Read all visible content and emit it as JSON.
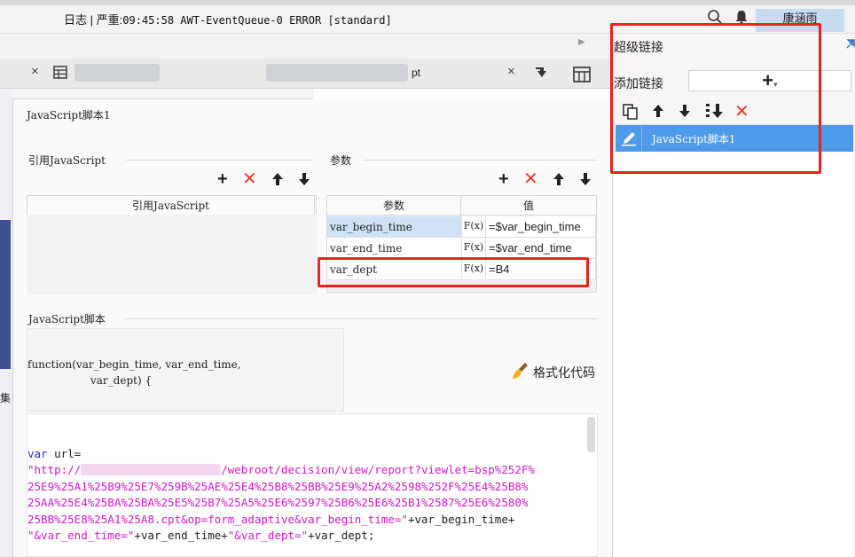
{
  "topbar": {
    "log_label": "日志",
    "severity_label": "严重",
    "log_message": "09:45:58 AWT-EventQueue-0 ERROR [standard]",
    "user_name": "康涵雨"
  },
  "tabs": {
    "tab1_close": "×",
    "tab2_partial": "pt",
    "tab2_close": "×"
  },
  "dialog": {
    "title": "JavaScript脚本1",
    "ref_js": {
      "section_title": "引用JavaScript",
      "column_header": "引用JavaScript"
    },
    "params": {
      "section_title": "参数",
      "headers": {
        "param": "参数",
        "value": "值"
      },
      "fx_label": "F(x)",
      "rows": [
        {
          "name": "var_begin_time",
          "value": "=$var_begin_time"
        },
        {
          "name": "var_end_time",
          "value": "=$var_end_time"
        },
        {
          "name": "var_dept",
          "value": "=B4"
        }
      ]
    },
    "script": {
      "section_title": "JavaScript脚本",
      "signature_line1": "function(var_begin_time, var_end_time,",
      "signature_line2": "var_dept) {",
      "format_button": "格式化代码",
      "code": {
        "line1_kw": "var",
        "line1_rest": " url=",
        "line2_a": "\"http://",
        "line2_b": "/webroot/decision/view/report?viewlet=bsp%252F%",
        "line3": "25E9%25A1%25B9%25E7%259B%25AE%25E4%25B8%25BB%25E9%25A2%2598%252F%25E4%25B8%",
        "line4": "25AA%25E4%25BA%25BA%25E5%25B7%25A5%25E6%2597%25B6%25E6%25B1%2587%25E6%2580%",
        "line5_str": "25BB%25E8%25A1%25A8.cpt&op=form_adaptive&var_begin_time=\"",
        "line5_rest": "+var_begin_time+",
        "line6_str1": "\"&var_end_time=\"",
        "line6_mid": "+var_end_time+",
        "line6_str2": "\"&var_dept=\"",
        "line6_rest": "+var_dept;"
      }
    }
  },
  "right_panel": {
    "title": "超级链接",
    "add_link_label": "添加链接",
    "add_button": "+",
    "items": [
      {
        "label": "JavaScript脚本1"
      }
    ]
  },
  "colors": {
    "accent": "#4d9be8",
    "delete_red": "#e63d2b",
    "highlight_box": "#e8231f",
    "keyword": "#1f2bd6",
    "string": "#d218c9"
  },
  "icons": [
    "search-icon",
    "bell-icon",
    "copy-icon",
    "arrow-up-icon",
    "arrow-down-icon",
    "sort-icon",
    "delete-icon",
    "edit-icon",
    "broom-icon",
    "expand-icon"
  ]
}
